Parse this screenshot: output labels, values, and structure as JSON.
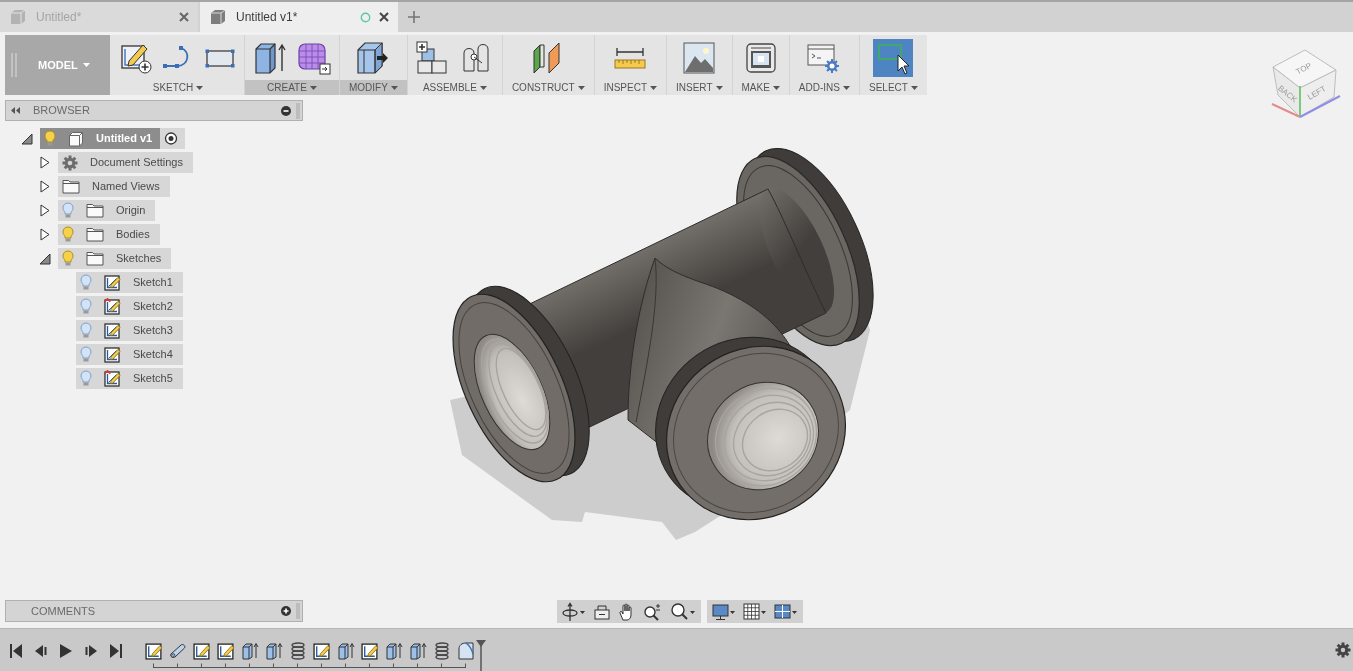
{
  "tabs": [
    {
      "label": "Untitled*",
      "selected": false
    },
    {
      "label": "Untitled v1*",
      "selected": true
    }
  ],
  "toolbar": {
    "mode": "MODEL",
    "groups": [
      {
        "label": "SKETCH",
        "highlighted": false
      },
      {
        "label": "CREATE",
        "highlighted": true
      },
      {
        "label": "MODIFY",
        "highlighted": true
      },
      {
        "label": "ASSEMBLE",
        "highlighted": false
      },
      {
        "label": "CONSTRUCT",
        "highlighted": false
      },
      {
        "label": "INSPECT",
        "highlighted": false
      },
      {
        "label": "INSERT",
        "highlighted": false
      },
      {
        "label": "MAKE",
        "highlighted": false
      },
      {
        "label": "ADD-INS",
        "highlighted": false
      },
      {
        "label": "SELECT",
        "highlighted": false
      }
    ]
  },
  "browser": {
    "title": "BROWSER",
    "tree": [
      {
        "label": "Untitled v1",
        "kind": "component",
        "selected": true,
        "expanded": true,
        "visible": true,
        "active": true,
        "children": [
          {
            "label": "Document Settings",
            "kind": "settings",
            "selected": false,
            "expanded": false
          },
          {
            "label": "Named Views",
            "kind": "folder",
            "selected": false,
            "expanded": false
          },
          {
            "label": "Origin",
            "kind": "folder",
            "selected": false,
            "expanded": false,
            "visible": false
          },
          {
            "label": "Bodies",
            "kind": "folder",
            "selected": false,
            "expanded": false,
            "visible": true
          },
          {
            "label": "Sketches",
            "kind": "folder",
            "selected": false,
            "expanded": true,
            "visible": true,
            "children": [
              {
                "label": "Sketch1",
                "kind": "sketch",
                "selected": false,
                "visible": false,
                "warning": false
              },
              {
                "label": "Sketch2",
                "kind": "sketch",
                "selected": false,
                "visible": false,
                "warning": true
              },
              {
                "label": "Sketch3",
                "kind": "sketch",
                "selected": false,
                "visible": false,
                "warning": false
              },
              {
                "label": "Sketch4",
                "kind": "sketch",
                "selected": false,
                "visible": false,
                "warning": false
              },
              {
                "label": "Sketch5",
                "kind": "sketch",
                "selected": false,
                "visible": false,
                "warning": true
              }
            ]
          }
        ]
      }
    ]
  },
  "view_cube": {
    "faces": [
      "TOP",
      "BACK",
      "LEFT"
    ]
  },
  "comments": {
    "title": "COMMENTS"
  },
  "timeline": {
    "features": [
      {
        "kind": "sketch"
      },
      {
        "kind": "pipe"
      },
      {
        "kind": "sketch"
      },
      {
        "kind": "sketch"
      },
      {
        "kind": "extrude"
      },
      {
        "kind": "extrude"
      },
      {
        "kind": "coil"
      },
      {
        "kind": "sketch"
      },
      {
        "kind": "extrude"
      },
      {
        "kind": "sketch"
      },
      {
        "kind": "extrude"
      },
      {
        "kind": "extrude"
      },
      {
        "kind": "coil"
      },
      {
        "kind": "fillet"
      }
    ]
  }
}
